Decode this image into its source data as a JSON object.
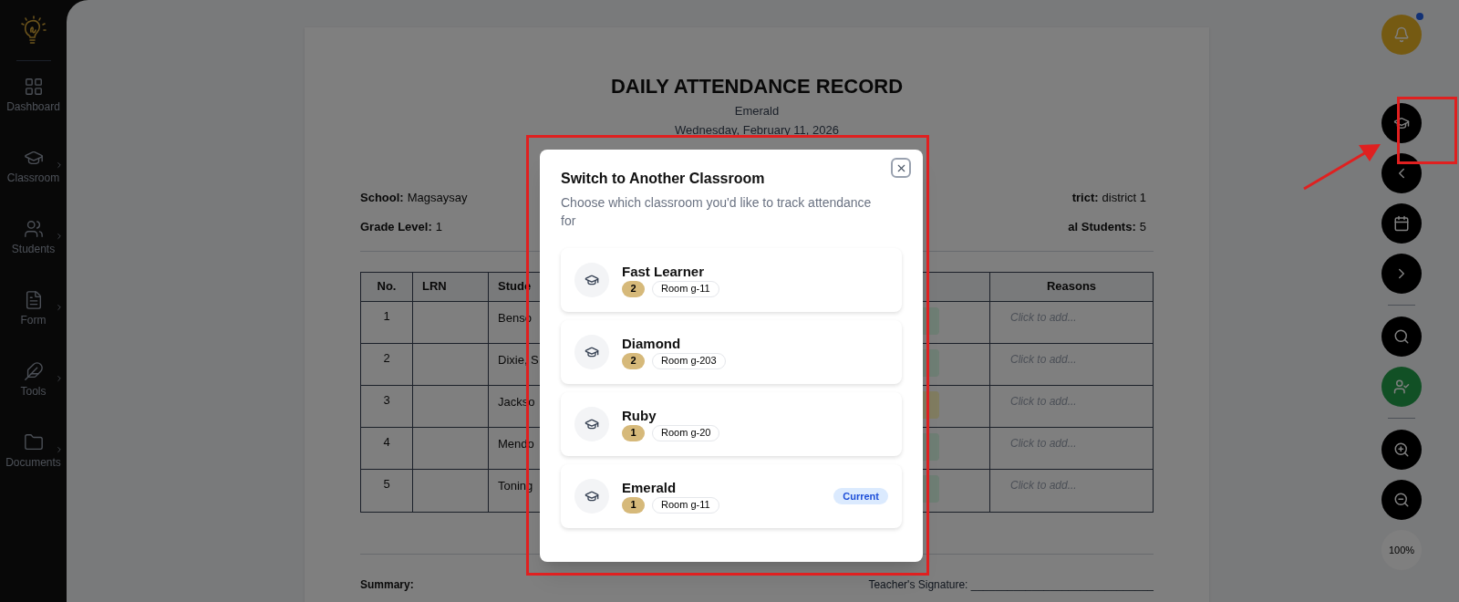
{
  "sidebar": {
    "items": [
      {
        "label": "Dashboard",
        "expandable": false
      },
      {
        "label": "Classroom",
        "expandable": true
      },
      {
        "label": "Students",
        "expandable": true
      },
      {
        "label": "Form",
        "expandable": true
      },
      {
        "label": "Tools",
        "expandable": true
      },
      {
        "label": "Documents",
        "expandable": true
      }
    ]
  },
  "record": {
    "title": "DAILY ATTENDANCE RECORD",
    "classroom": "Emerald",
    "date": "Wednesday, February 11, 2026",
    "fields": [
      {
        "label": "School:",
        "value": "Magsaysay"
      },
      {
        "label": "trict:",
        "value": "district 1"
      },
      {
        "label": "Grade Level:",
        "value": "1"
      },
      {
        "label": "al Students:",
        "value": "5"
      }
    ]
  },
  "table": {
    "columns": [
      "No.",
      "LRN",
      "Stude",
      "Reasons"
    ],
    "rows": [
      {
        "no": "1",
        "student": "Benso",
        "color": "#6e7e74",
        "reasons": "Click to add..."
      },
      {
        "no": "2",
        "student": "Dixie, S",
        "color": "#6e7e74",
        "reasons": "Click to add..."
      },
      {
        "no": "3",
        "student": "Jackso",
        "color": "#807c60",
        "reasons": "Click to add..."
      },
      {
        "no": "4",
        "student": "Mendo",
        "color": "#6e7e74",
        "reasons": "Click to add..."
      },
      {
        "no": "5",
        "student": "Toning",
        "color": "#6e7e74",
        "reasons": "Click to add..."
      }
    ]
  },
  "footer": {
    "summary": "Summary:",
    "signature": "Teacher's Signature: ______________________________"
  },
  "toolbar": {
    "notification": true,
    "zoom": "100%"
  },
  "modal": {
    "title": "Switch to Another Classroom",
    "subtitle": "Choose which classroom you'd like to track attendance for",
    "current_label": "Current",
    "classrooms": [
      {
        "name": "Fast Learner",
        "count": "2",
        "room": "Room g-11",
        "current": false
      },
      {
        "name": "Diamond",
        "count": "2",
        "room": "Room g-203",
        "current": false
      },
      {
        "name": "Ruby",
        "count": "1",
        "room": "Room g-20",
        "current": false
      },
      {
        "name": "Emerald",
        "count": "1",
        "room": "Room g-11",
        "current": true
      }
    ]
  }
}
